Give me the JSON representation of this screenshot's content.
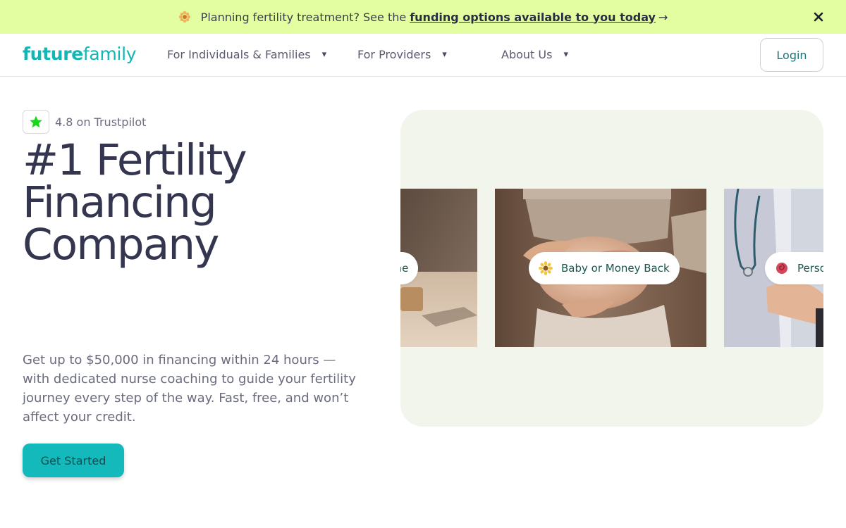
{
  "banner": {
    "text": "Planning fertility treatment? See the",
    "link_text": "funding options available to you today",
    "arrow": "→",
    "icon": "flower-icon",
    "close_icon": "close-icon"
  },
  "header": {
    "logo_part1": "future",
    "logo_part2": "family",
    "nav": [
      {
        "label": "For Individuals & Families",
        "caret": "▾"
      },
      {
        "label": "For Providers",
        "caret": "▾"
      },
      {
        "label": "About Us",
        "caret": "▾"
      }
    ],
    "login_label": "Login"
  },
  "hero": {
    "rating_text": "4.8 on Trustpilot",
    "rating_icon": "star-icon",
    "headline_lines": [
      "#1 Fertility",
      "Financing",
      "Company"
    ],
    "subcopy": "Get up to $50,000 in financing within 24 hours — with dedicated nurse coaching to guide your fertility journey every step of the way. Fast, free, and won’t affect your credit.",
    "cta_label": "Get Started"
  },
  "carousel": {
    "cards": [
      {
        "label": "icine",
        "icon": "leaf-icon"
      },
      {
        "label": "Baby or Money Back",
        "icon": "sunflower-icon"
      },
      {
        "label": "Perso",
        "icon": "rose-icon"
      }
    ]
  },
  "colors": {
    "banner_bg": "#e2fea0",
    "brand_teal": "#13b5b5",
    "headline": "#343650",
    "carousel_bg": "#f2f5ec"
  }
}
